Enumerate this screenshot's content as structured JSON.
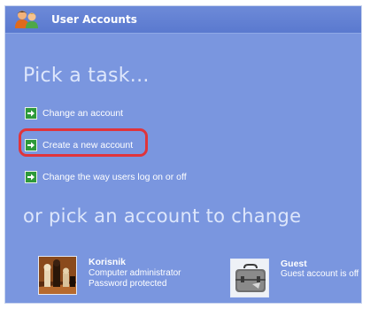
{
  "window": {
    "title": "User Accounts",
    "title_icon": "users-icon"
  },
  "tasks": {
    "heading": "Pick a task...",
    "items": [
      {
        "label": "Change an account",
        "icon": "green-arrow-icon"
      },
      {
        "label": "Create a new account",
        "icon": "green-arrow-icon",
        "highlighted": true
      },
      {
        "label": "Change the way users log on or off",
        "icon": "green-arrow-icon"
      }
    ]
  },
  "accounts": {
    "heading": "or pick an account to change",
    "items": [
      {
        "name": "Korisnik",
        "type": "Computer administrator",
        "status": "Password protected",
        "picture": "chess-pieces-picture"
      },
      {
        "name": "Guest",
        "type": "Guest account is off",
        "picture": "suitcase-picture"
      }
    ]
  },
  "colors": {
    "panel_background": "#7a96df",
    "title_bar": "#5a79cf",
    "heading_text": "#dde6fb",
    "arrow_green": "#2e9a3a",
    "highlight_ring": "#e0343b"
  }
}
